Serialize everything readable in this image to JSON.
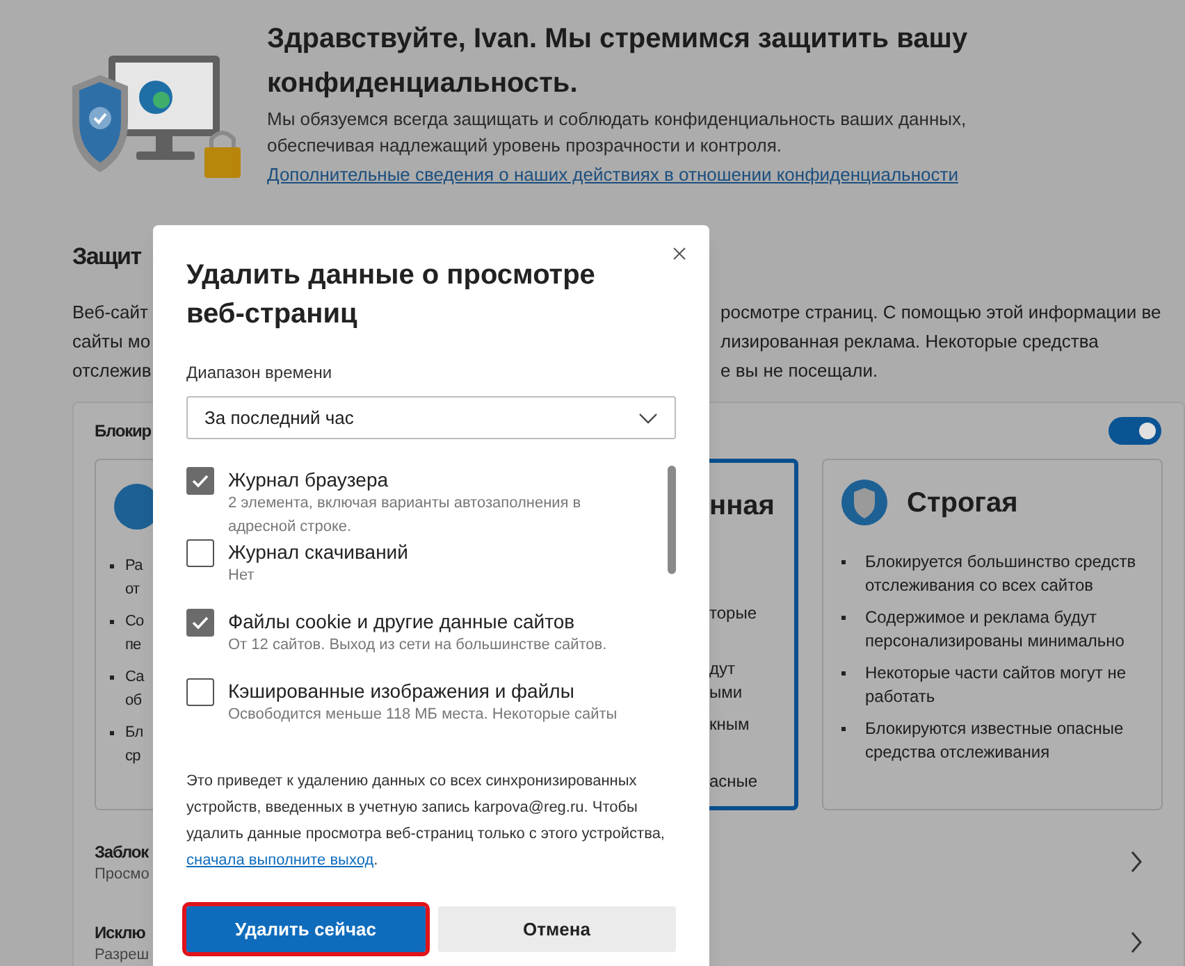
{
  "header": {
    "title": "Здравствуйте, Ivan. Мы стремимся защитить вашу конфиденциальность.",
    "paragraph": "Мы обязуемся всегда защищать и соблюдать конфиденциальность ваших данных, обеспечивая надлежащий уровень прозрачности и контроля.",
    "link": "Дополнительные сведения о наших действиях в отношении конфиденциальности"
  },
  "section": {
    "heading": "Защит",
    "paragraph_left": [
      "Веб-сайт",
      "сайты мо",
      "отслежив"
    ],
    "paragraph_right": [
      "росмотре страниц. С помощью этой информации ве",
      "лизированная реклама. Некоторые средства",
      "е вы не посещали."
    ]
  },
  "tracking_card": {
    "heading": "Блокир",
    "toggle_on": true,
    "options": [
      {
        "selected": false,
        "bullets": [
          [
            "Ра",
            "от"
          ],
          [
            "Со",
            "пе"
          ],
          [
            "Са",
            "об"
          ],
          [
            "Бл",
            "ср"
          ]
        ]
      },
      {
        "selected": true,
        "title": "нная",
        "fragments": [
          "торые",
          "дут",
          "ыми",
          "кным",
          "асные"
        ]
      },
      {
        "selected": false,
        "title": "Строгая",
        "bullets": [
          "Блокируется большинство средств отслеживания со всех сайтов",
          "Содержимое и реклама будут персонализированы минимально",
          "Некоторые части сайтов могут не работать",
          "Блокируются известные опасные средства отслеживания"
        ]
      }
    ],
    "rows": [
      {
        "title": "Заблок",
        "subtitle": "Просмо"
      },
      {
        "title": "Исклю",
        "subtitle": "Разреш"
      }
    ]
  },
  "dialog": {
    "title": "Удалить данные о просмотре веб-страниц",
    "range_label": "Диапазон времени",
    "range_value": "За последний час",
    "items": [
      {
        "label": "Журнал браузера",
        "description": "2 элемента, включая варианты автозаполнения в адресной строке.",
        "checked": true
      },
      {
        "label": "Журнал скачиваний",
        "description": "Нет",
        "checked": false
      },
      {
        "label": "Файлы cookie и другие данные сайтов",
        "description": "От 12 сайтов. Выход из сети на большинстве сайтов.",
        "checked": true
      },
      {
        "label": "Кэшированные изображения и файлы",
        "description": "Освободится меньше 118 МБ места. Некоторые сайты",
        "checked": false
      }
    ],
    "note_before": "Это приведет к удалению данных со всех синхронизированных устройств, введенных в учетную запись karpova@reg.ru. Чтобы удалить данные просмотра веб-страниц только с этого устройства,",
    "note_link": "сначала выполните выход",
    "note_after": ".",
    "buttons": [
      {
        "label": "Удалить сейчас",
        "kind": "primary",
        "highlighted": true
      },
      {
        "label": "Отмена",
        "kind": "secondary",
        "highlighted": false
      }
    ]
  }
}
